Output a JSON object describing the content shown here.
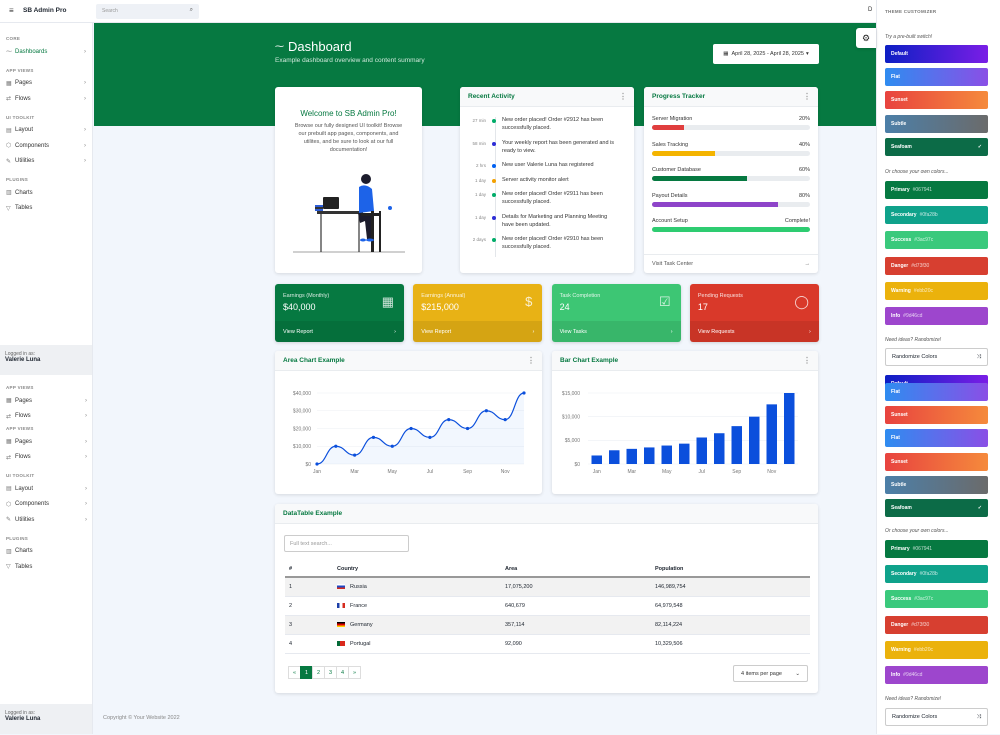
{
  "brand": "SB Admin Pro",
  "search_placeholder": "Search",
  "sidebar": {
    "core": "CORE",
    "dashboards": "Dashboards",
    "app_views": "APP VIEWS",
    "pages": "Pages",
    "flows": "Flows",
    "ui_toolkit": "UI TOOLKIT",
    "layout": "Layout",
    "components": "Components",
    "utilities": "Utilities",
    "plugins": "PLUGINS",
    "charts": "Charts",
    "tables": "Tables",
    "logged_in_as": "Logged in as:",
    "user": "Valerie Luna"
  },
  "header": {
    "title": "Dashboard",
    "subtitle": "Example dashboard overview and content summary",
    "date_range": "April 28, 2025 - April 28, 2025"
  },
  "welcome": {
    "title": "Welcome to SB Admin Pro!",
    "body": "Browse our fully designed UI toolkit! Browse our prebuilt app pages, components, and utilites, and be sure to look at our full documentation!"
  },
  "activity": {
    "title": "Recent Activity",
    "items": [
      {
        "time": "27 min",
        "text": "New order placed! Order #2912 has been successfully placed.",
        "color": "#00ac69"
      },
      {
        "time": "58 min",
        "text": "Your weekly report has been generated and is ready to view.",
        "color": "#2d2dd6"
      },
      {
        "time": "2 hrs",
        "text": "New user Valerie Luna has registered",
        "color": "#0061f2"
      },
      {
        "time": "1 day",
        "text": "Server activity monitor alert",
        "color": "#f4a100"
      },
      {
        "time": "1 day",
        "text": "New order placed! Order #2911 has been successfully placed.",
        "color": "#00ac69"
      },
      {
        "time": "1 day",
        "text": "Details for Marketing and Planning Meeting have been updated.",
        "color": "#2d2dd6"
      },
      {
        "time": "2 days",
        "text": "New order placed! Order #2910 has been successfully placed.",
        "color": "#00ac69"
      }
    ]
  },
  "progress": {
    "title": "Progress Tracker",
    "footer": "Visit Task Center",
    "items": [
      {
        "label": "Server Migration",
        "value": "20%",
        "pct": 20,
        "color": "#e03e3e"
      },
      {
        "label": "Sales Tracking",
        "value": "40%",
        "pct": 40,
        "color": "#f4b400"
      },
      {
        "label": "Customer Database",
        "value": "60%",
        "pct": 60,
        "color": "#067941"
      },
      {
        "label": "Payout Details",
        "value": "80%",
        "pct": 80,
        "color": "#8e44c9"
      },
      {
        "label": "Account Setup",
        "value": "Complete!",
        "pct": 100,
        "color": "#2ecc71"
      }
    ]
  },
  "stats": [
    {
      "label": "Earnings (Monthly)",
      "value": "$40,000",
      "link": "View Report",
      "color": "#067941",
      "icon": "calendar-icon"
    },
    {
      "label": "Earnings (Annual)",
      "value": "$215,000",
      "link": "View Report",
      "color": "#e8b215",
      "icon": "dollar-icon"
    },
    {
      "label": "Task Completion",
      "value": "24",
      "link": "View Tasks",
      "color": "#3dc674",
      "icon": "check-square-icon"
    },
    {
      "label": "Pending Requests",
      "value": "17",
      "link": "View Requests",
      "color": "#d9392a",
      "icon": "message-icon"
    }
  ],
  "area_chart": {
    "title": "Area Chart Example"
  },
  "bar_chart": {
    "title": "Bar Chart Example"
  },
  "chart_data": [
    {
      "type": "area",
      "title": "Area Chart Example",
      "x_ticks": [
        "Jan",
        "Mar",
        "May",
        "Jul",
        "Sep",
        "Nov"
      ],
      "y_ticks": [
        "$0",
        "$10,000",
        "$20,000",
        "$30,000",
        "$40,000"
      ],
      "ylim": [
        0,
        40000
      ],
      "values": [
        0,
        10000,
        5000,
        15000,
        10000,
        20000,
        15000,
        25000,
        20000,
        30000,
        25000,
        40000
      ]
    },
    {
      "type": "bar",
      "title": "Bar Chart Example",
      "x_ticks": [
        "Jan",
        "Mar",
        "May",
        "Jul",
        "Sep",
        "Nov"
      ],
      "y_ticks": [
        "$0",
        "$5,000",
        "$10,000",
        "$15,000"
      ],
      "ylim": [
        0,
        15000
      ],
      "values": [
        1800,
        2900,
        3200,
        3500,
        3900,
        4300,
        5600,
        6500,
        8000,
        10000,
        12600,
        15000
      ]
    }
  ],
  "datatable": {
    "title": "DataTable Example",
    "search_placeholder": "Full text search...",
    "columns": [
      "#",
      "Country",
      "Area",
      "Population"
    ],
    "rows": [
      [
        "1",
        "Russia",
        "17,075,200",
        "146,989,754"
      ],
      [
        "2",
        "France",
        "640,679",
        "64,979,548"
      ],
      [
        "3",
        "Germany",
        "357,114",
        "82,114,224"
      ],
      [
        "4",
        "Portugal",
        "92,090",
        "10,329,506"
      ]
    ],
    "pages": [
      "«",
      "1",
      "2",
      "3",
      "4",
      "»"
    ],
    "per_page": "4 items per page"
  },
  "footer": "Copyright © Your Website 2022",
  "customizer": {
    "title": "THEME CUSTOMIZER",
    "prebuilt": "Try a pre-built switch!",
    "own": "Or choose your own colors...",
    "ideas": "Need ideas? Randomize!",
    "randomize": "Randomize Colors",
    "themes": [
      "Default",
      "Flat",
      "Sunset",
      "Subtle",
      "Seafoam"
    ],
    "colors": [
      {
        "name": "Primary",
        "hex": "#067941"
      },
      {
        "name": "Secondary",
        "hex": "#0fa28b"
      },
      {
        "name": "Success",
        "hex": "#3ac97c"
      },
      {
        "name": "Danger",
        "hex": "#d73f30"
      },
      {
        "name": "Warning",
        "hex": "#ebb20c"
      },
      {
        "name": "Info",
        "hex": "#9d46cd"
      }
    ]
  }
}
